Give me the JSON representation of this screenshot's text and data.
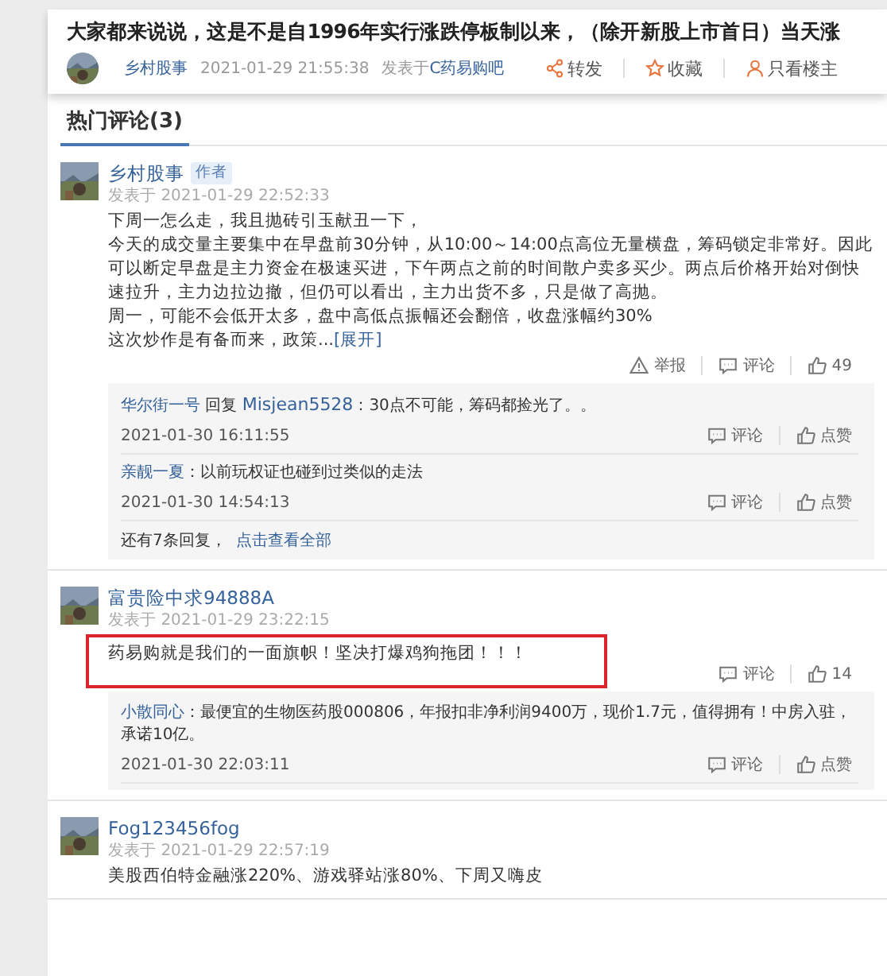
{
  "post": {
    "title": "大家都来说说，这是不是自1996年实行涨跌停板制以来，（除开新股上市首日）当天涨",
    "author": "乡村股事",
    "time": "2021-01-29 21:55:38",
    "forum_prefix": "发表于",
    "forum": "C药易购吧",
    "actions": [
      {
        "kind": "share",
        "label": "转发"
      },
      {
        "kind": "favorite",
        "label": "收藏"
      },
      {
        "kind": "author-only",
        "label": "只看楼主"
      }
    ]
  },
  "tabs": [
    {
      "label": "热门评论(3)",
      "selected": true
    }
  ],
  "comments": [
    {
      "name": "乡村股事",
      "badge": "作者",
      "time_prefix": "发表于",
      "time": "2021-01-29 22:52:33",
      "highlighted": false,
      "body": [
        "下周一怎么走，我且抛砖引玉献丑一下，",
        "今天的成交量主要集中在早盘前30分钟，从10:00～14:00点高位无量横盘，筹码锁定非常好。因此可以断定早盘是主力资金在极速买进，下午两点之前的时间散户卖多买少。两点后价格开始对倒快速拉升，主力边拉边撤，但仍可以看出，主力出货不多，只是做了高抛。",
        "周一，可能不会低开太多，盘中高低点振幅还会翻倍，收盘涨幅约30%",
        "这次炒作是有备而来，政策..."
      ],
      "expand": "[展开]",
      "actions": [
        {
          "kind": "report",
          "label": "举报"
        },
        {
          "kind": "comment",
          "label": "评论"
        },
        {
          "kind": "like",
          "label": "49"
        }
      ],
      "replies": [
        {
          "name": "华尔街一号",
          "reply_word": "回复",
          "target": "Misjean5528",
          "text": "：30点不可能，筹码都捡光了。。",
          "time": "2021-01-30 16:11:55",
          "actions": [
            {
              "kind": "comment",
              "label": "评论"
            },
            {
              "kind": "like",
              "label": "点赞"
            }
          ]
        },
        {
          "name": "亲靓一夏",
          "text": "：以前玩权证也碰到过类似的走法",
          "time": "2021-01-30 14:54:13",
          "actions": [
            {
              "kind": "comment",
              "label": "评论"
            },
            {
              "kind": "like",
              "label": "点赞"
            }
          ]
        }
      ],
      "more": {
        "text": "还有7条回复，",
        "link": "点击查看全部"
      }
    },
    {
      "name": "富贵险中求94888A",
      "time_prefix": "发表于",
      "time": "2021-01-29 23:22:15",
      "highlighted": true,
      "body": [
        "药易购就是我们的一面旗帜！坚决打爆鸡狗拖团！！！"
      ],
      "actions": [
        {
          "kind": "comment",
          "label": "评论"
        },
        {
          "kind": "like",
          "label": "14"
        }
      ],
      "replies": [
        {
          "name": "小散同心",
          "text": "：最便宜的生物医药股000806，年报扣非净利润9400万，现价1.7元，值得拥有！中房入驻，承诺10亿。",
          "time": "2021-01-30 22:03:11",
          "actions": [
            {
              "kind": "comment",
              "label": "评论"
            },
            {
              "kind": "like",
              "label": "点赞"
            }
          ]
        }
      ]
    },
    {
      "name": "Fog123456fog",
      "time_prefix": "发表于",
      "time": "2021-01-29 22:57:19",
      "highlighted": false,
      "body": [
        "美股西伯特金融涨220%、游戏驿站涨80%、下周又嗨皮"
      ]
    }
  ]
}
